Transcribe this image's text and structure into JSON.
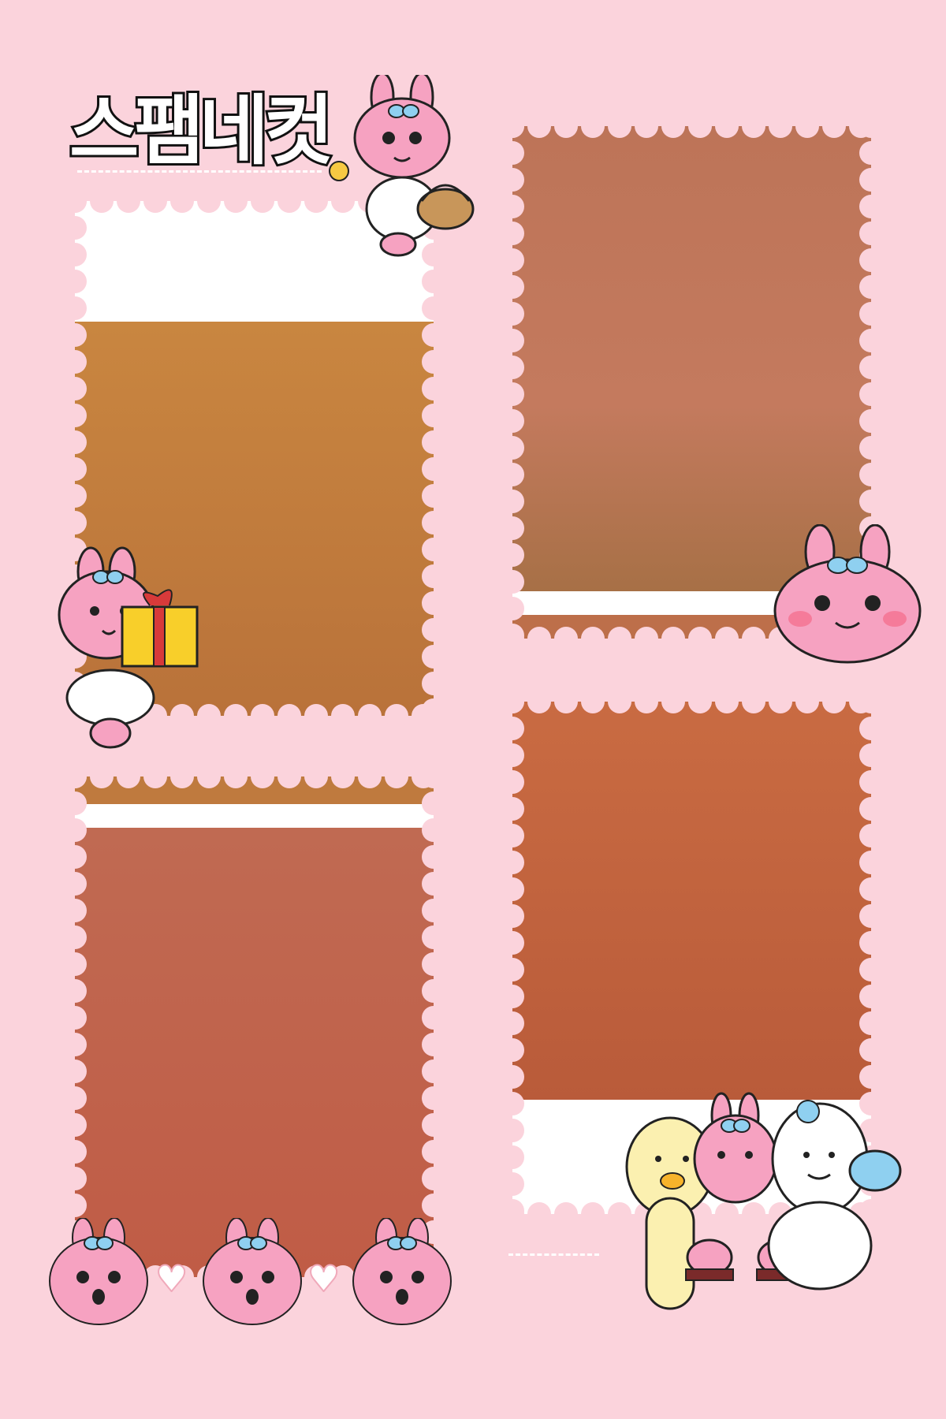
{
  "title": "스팸네컷",
  "colors": {
    "background": "#fbd3dc",
    "frame_edge": "#fbd3dc",
    "white_band": "#ffffff",
    "photo1": [
      "#c57d3e",
      "#c07a3a"
    ],
    "photo2": [
      "#c07660",
      "#b5704a"
    ],
    "photo3": [
      "#c56a4a",
      "#c2583e"
    ],
    "photo4": [
      "#c9683e",
      "#b9583a"
    ],
    "character_pink": "#f6a2c1",
    "bow_blue": "#8fd0f0"
  },
  "frames": [
    {
      "id": "frame-1",
      "label": "photo-1"
    },
    {
      "id": "frame-2",
      "label": "photo-2"
    },
    {
      "id": "frame-3",
      "label": "photo-3"
    },
    {
      "id": "frame-4",
      "label": "photo-4"
    }
  ],
  "stickers": {
    "top": "rabbit-with-basket-icon",
    "left": "rabbit-with-gift-icon",
    "right": "rabbit-face-icon",
    "bottom_left": [
      "rabbit-icon",
      "heart-icon",
      "rabbit-icon",
      "heart-icon",
      "rabbit-icon"
    ],
    "bottom_right": "friends-group-icon"
  }
}
